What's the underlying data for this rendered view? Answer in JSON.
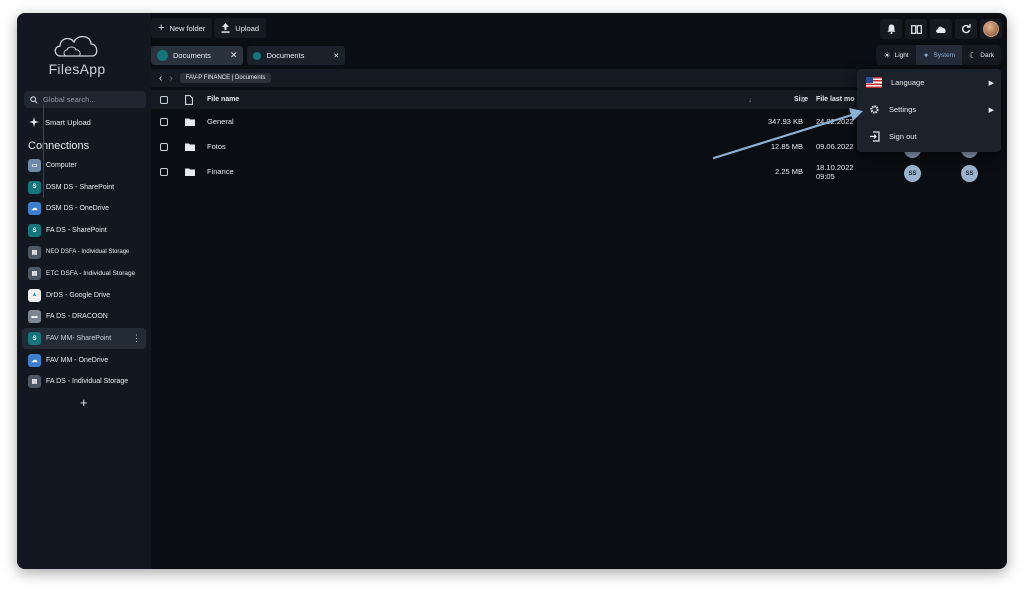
{
  "app": {
    "name": "FilesApp"
  },
  "toolbar": {
    "new_folder_label": "New folder",
    "upload_label": "Upload"
  },
  "sidebar": {
    "search_placeholder": "Global search...",
    "smart_upload_label": "Smart Upload",
    "connections_title": "Connections",
    "connections": [
      {
        "label": "Computer",
        "icon": "computer-icon"
      },
      {
        "label": "DSM DS - SharePoint",
        "icon": "sharepoint-icon"
      },
      {
        "label": "DSM DS - OneDrive",
        "icon": "onedrive-icon"
      },
      {
        "label": "FA DS - SharePoint",
        "icon": "sharepoint-icon"
      },
      {
        "label": "NEO DSFA - Individual Storage",
        "icon": "storage-icon"
      },
      {
        "label": "ETC DSFA - Individual Storage",
        "icon": "storage-icon"
      },
      {
        "label": "DrDS - Google Drive",
        "icon": "google-drive-icon"
      },
      {
        "label": "FA DS - DRACOON",
        "icon": "dracoon-icon"
      },
      {
        "label": "FAV MM- SharePoint",
        "icon": "sharepoint-icon",
        "active": true
      },
      {
        "label": "FAV MM - OneDrive",
        "icon": "onedrive-icon"
      },
      {
        "label": "FA DS - Individual Storage",
        "icon": "storage-icon"
      }
    ],
    "add_label": "+"
  },
  "tabs": [
    {
      "label": "Documents",
      "active": true
    },
    {
      "label": "Documents",
      "active": false
    }
  ],
  "theme": {
    "options": [
      "Light",
      "System",
      "Dark"
    ],
    "selected": "System"
  },
  "pathbar": {
    "breadcrumb": "FAV-P FINANCE | Documents"
  },
  "table": {
    "columns": {
      "name": "File name",
      "size": "Size",
      "modified": "File last mo"
    },
    "rows": [
      {
        "name": "General",
        "size": "347.93 KB",
        "modified": "24.02.2022",
        "avatars": []
      },
      {
        "name": "Fotos",
        "size": "12.85 MB",
        "modified": "09.06.2022",
        "avatars": []
      },
      {
        "name": "Finance",
        "size": "2.25 MB",
        "modified": "18.10.2022 09:05",
        "avatars": [
          "SS",
          "SS"
        ]
      }
    ]
  },
  "menu": {
    "items": [
      {
        "label": "Language",
        "icon": "us-flag-icon",
        "submenu": true
      },
      {
        "label": "Settings",
        "icon": "gear-icon",
        "submenu": true
      },
      {
        "label": "Sign out",
        "icon": "sign-out-icon",
        "submenu": false
      }
    ]
  },
  "colors": {
    "window_bg": "#0a0d12",
    "sidebar_bg": "#131820",
    "accent": "#8aa6c8",
    "avatar_badge": "#9bb3cc"
  }
}
